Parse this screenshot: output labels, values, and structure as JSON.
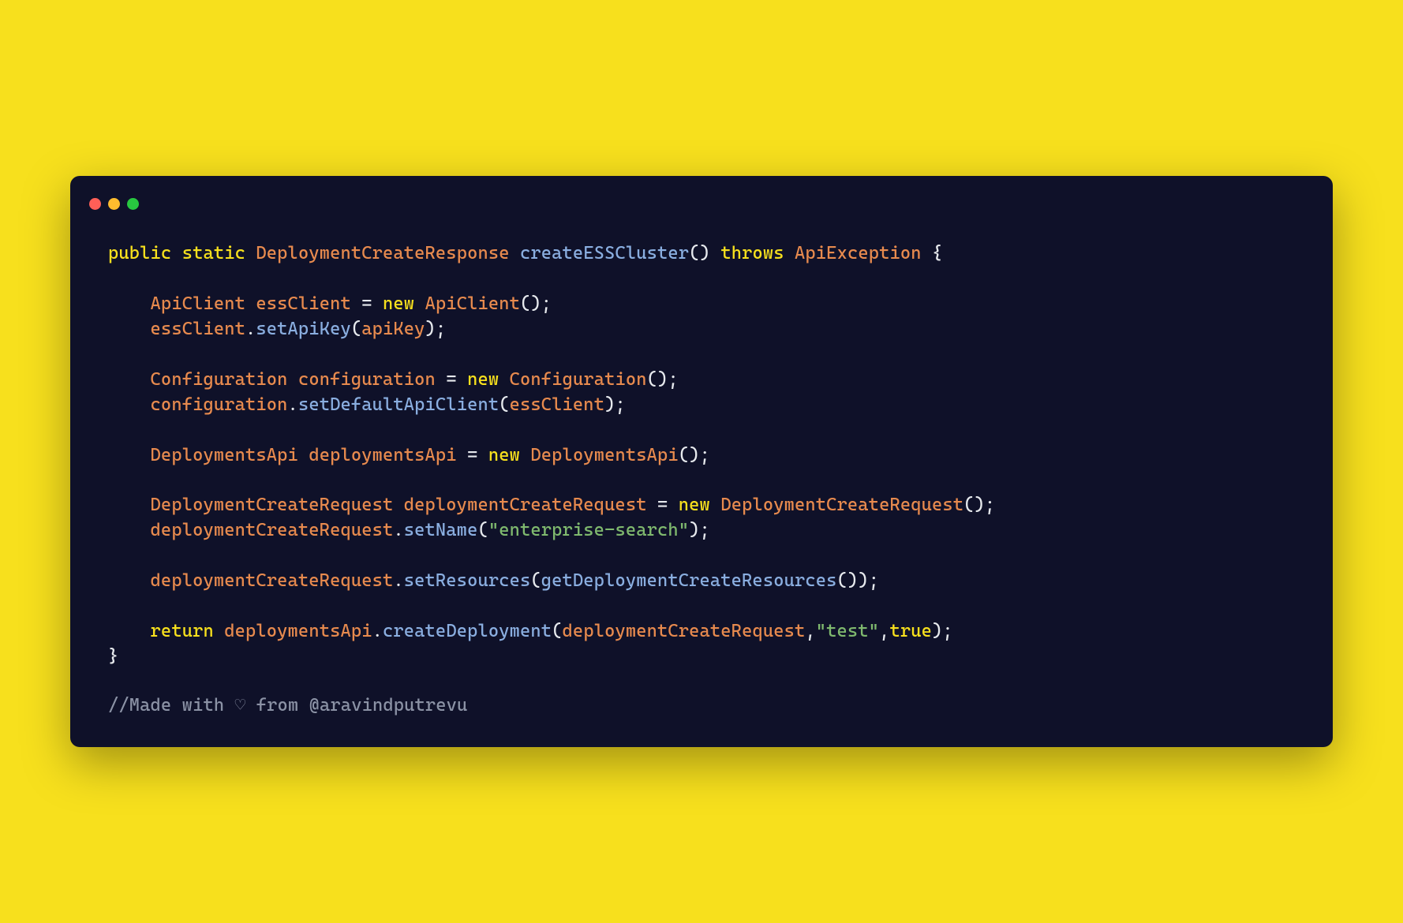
{
  "titlebar": {
    "icons": [
      "close",
      "minimize",
      "zoom"
    ]
  },
  "code": {
    "tokens": {
      "public": "public",
      "static": "static",
      "type1": "DeploymentCreateResponse",
      "fn1": "createESSCluster",
      "throws": "throws",
      "ex": "ApiException",
      "brace_open": "{",
      "brace_close": "}",
      "paren_open": "(",
      "paren_close": ")",
      "semi": ";",
      "dot": ".",
      "eq": "=",
      "comma": ",",
      "new": "new",
      "return": "return",
      "t_ApiClient": "ApiClient",
      "v_essClient": "essClient",
      "m_setApiKey": "setApiKey",
      "v_apiKey": "apiKey",
      "t_Configuration": "Configuration",
      "v_configuration": "configuration",
      "m_setDefaultApiClient": "setDefaultApiClient",
      "t_DeploymentsApi": "DeploymentsApi",
      "v_deploymentsApi": "deploymentsApi",
      "t_DeploymentCreateRequest": "DeploymentCreateRequest",
      "v_deploymentCreateRequest": "deploymentCreateRequest",
      "m_setName": "setName",
      "s_enterprise": "\"enterprise-search\"",
      "m_setResources": "setResources",
      "m_getDeploymentCreateResources": "getDeploymentCreateResources",
      "m_createDeployment": "createDeployment",
      "s_test": "\"test\"",
      "b_true": "true",
      "comment_prefix": "//Made with ",
      "heart": "♡",
      "comment_suffix": " from @aravindputrevu"
    }
  }
}
